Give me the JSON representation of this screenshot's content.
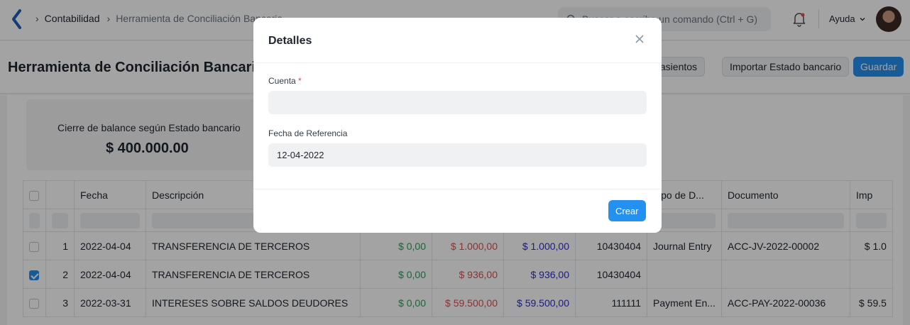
{
  "navbar": {
    "breadcrumbs": [
      "Contabilidad",
      "Herramienta de Conciliación Bancaria"
    ],
    "search_placeholder": "Buscar o escriba un comando (Ctrl + G)",
    "help_label": "Ayuda"
  },
  "page": {
    "title": "Herramienta de Conciliación Bancaria",
    "buttons": {
      "create_entries": "Crear asientos",
      "import_statement": "Importar Estado bancario",
      "save": "Guardar"
    }
  },
  "summary": {
    "label": "Cierre de balance según Estado bancario",
    "amount": "$ 400.000.00"
  },
  "table": {
    "columns": [
      "Fecha",
      "Descripción",
      "",
      "",
      "",
      "",
      "Tipo de D...",
      "Documento",
      "Imp"
    ],
    "rows": [
      {
        "num": "1",
        "fecha": "2022-04-04",
        "desc": "TRANSFERENCIA DE TERCEROS",
        "deposit": "$ 0,00",
        "withdraw": "$ 1.000,00",
        "unallocated": "$ 1.000,00",
        "ref": "10430404",
        "tipo": "Journal Entry",
        "doc": "ACC-JV-2022-00002",
        "imp": "$ 1.0",
        "checked": false
      },
      {
        "num": "2",
        "fecha": "2022-04-04",
        "desc": "TRANSFERENCIA DE TERCEROS",
        "deposit": "$ 0,00",
        "withdraw": "$ 936,00",
        "unallocated": "$ 936,00",
        "ref": "10430404",
        "tipo": "",
        "doc": "",
        "imp": "",
        "checked": true
      },
      {
        "num": "3",
        "fecha": "2022-03-31",
        "desc": "INTERESES SOBRE SALDOS DEUDORES",
        "deposit": "$ 0,00",
        "withdraw": "$ 59.500,00",
        "unallocated": "$ 59.500,00",
        "ref": "111111",
        "tipo": "Payment En...",
        "doc": "ACC-PAY-2022-00036",
        "imp": "$ 59.5",
        "checked": false
      }
    ]
  },
  "modal": {
    "title": "Detalles",
    "account_label": "Cuenta",
    "required_mark": "*",
    "account_value": "",
    "date_label": "Fecha de Referencia",
    "date_value": "12-04-2022",
    "create_button": "Crear"
  },
  "colors": {
    "primary": "#2490ef",
    "positive": "#26a556",
    "negative": "#e24c4c",
    "link_blue": "#2b2bd6"
  }
}
